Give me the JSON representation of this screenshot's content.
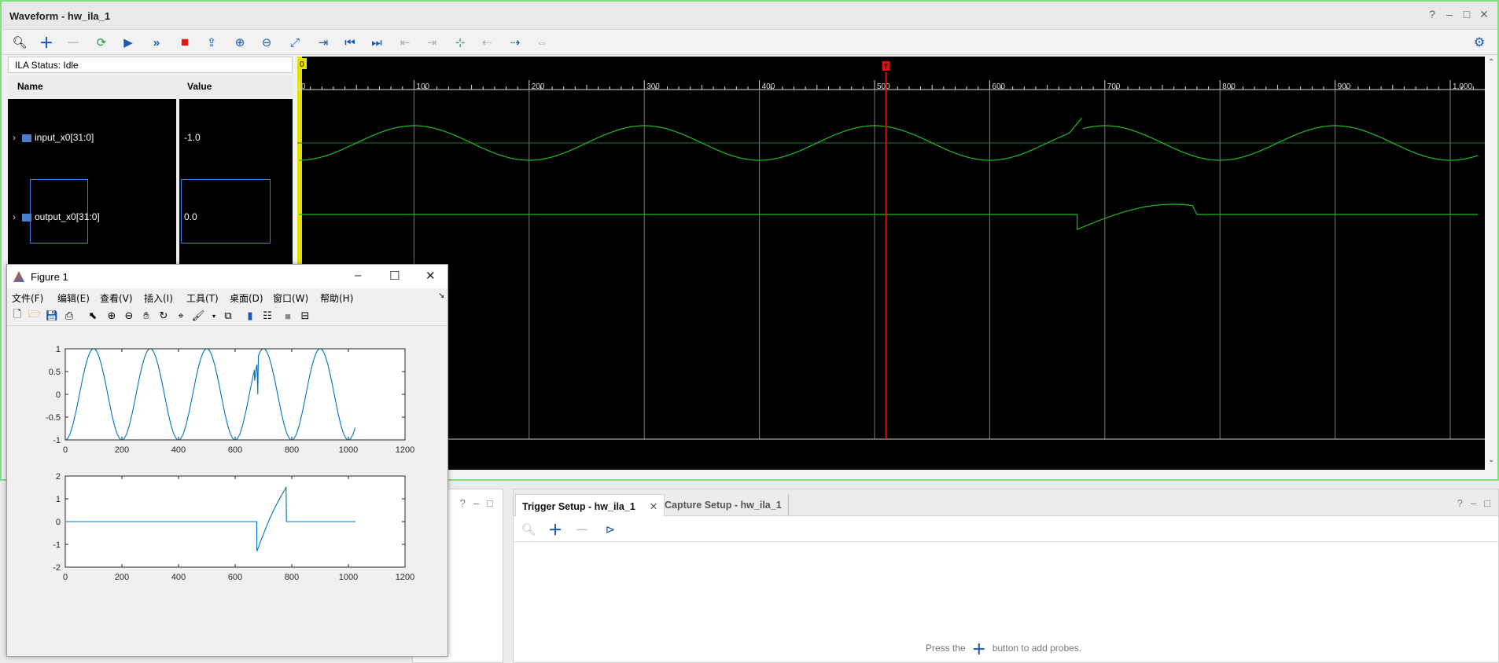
{
  "waveform_window": {
    "title": "Waveform - hw_ila_1",
    "controls": [
      "?",
      "–",
      "□",
      "✕"
    ],
    "ila_status": "ILA Status: Idle",
    "columns": {
      "name": "Name",
      "value": "Value"
    },
    "signals": [
      {
        "name": "input_x0[31:0]",
        "value": "-1.0"
      },
      {
        "name": "output_x0[31:0]",
        "value": "0.0"
      }
    ],
    "ruler": {
      "start_marker": "0",
      "tick_labels": [
        "0",
        "100",
        "200",
        "300",
        "400",
        "500",
        "600",
        "700",
        "800",
        "900",
        "1,000"
      ],
      "cursor_label": "T",
      "cursor_position": 510
    },
    "colors": {
      "wave": "#22bb22",
      "cursor": "#e01010",
      "active_border": "#7fe07f"
    }
  },
  "bottom_left_panel": {
    "controls": [
      "?",
      "–",
      "□"
    ]
  },
  "trigger_panel": {
    "tabs": [
      {
        "label": "Trigger Setup - hw_ila_1",
        "close": "✕"
      },
      {
        "label": "Capture Setup - hw_ila_1"
      }
    ],
    "controls": [
      "?",
      "–",
      "□"
    ],
    "hint_before": "Press the",
    "hint_after": "button to add probes."
  },
  "figure_window": {
    "title": "Figure 1",
    "menu": [
      "文件(F)",
      "编辑(E)",
      "查看(V)",
      "插入(I)",
      "工具(T)",
      "桌面(D)",
      "窗口(W)",
      "帮助(H)"
    ]
  },
  "chart_data": [
    {
      "type": "line",
      "series": [
        {
          "x": [
            0,
            100,
            200,
            300,
            400,
            500,
            600,
            669,
            675,
            677,
            680,
            690,
            725,
            800,
            925,
            1000,
            1024
          ],
          "y": [
            -1,
            1,
            -1,
            1,
            -1,
            1,
            -1,
            0.3,
            0.6,
            0.65,
            0,
            0.2,
            1,
            -1,
            1,
            -0.7,
            -1
          ]
        }
      ],
      "xlim": [
        0,
        1200
      ],
      "ylim": [
        -1,
        1
      ],
      "xticks": [
        "0",
        "200",
        "400",
        "600",
        "800",
        "1000",
        "1200"
      ],
      "yticks": [
        "-1",
        "-0.5",
        "0",
        "0.5",
        "1"
      ]
    },
    {
      "type": "line",
      "series": [
        {
          "x": [
            0,
            676,
            677,
            700,
            750,
            780,
            781,
            1024
          ],
          "y": [
            0,
            0,
            -1.3,
            -0.5,
            1.2,
            1.5,
            0,
            0
          ]
        }
      ],
      "xlim": [
        0,
        1200
      ],
      "ylim": [
        -2,
        2
      ],
      "xticks": [
        "0",
        "200",
        "400",
        "600",
        "800",
        "1000",
        "1200"
      ],
      "yticks": [
        "-2",
        "-1",
        "0",
        "1",
        "2"
      ]
    }
  ]
}
